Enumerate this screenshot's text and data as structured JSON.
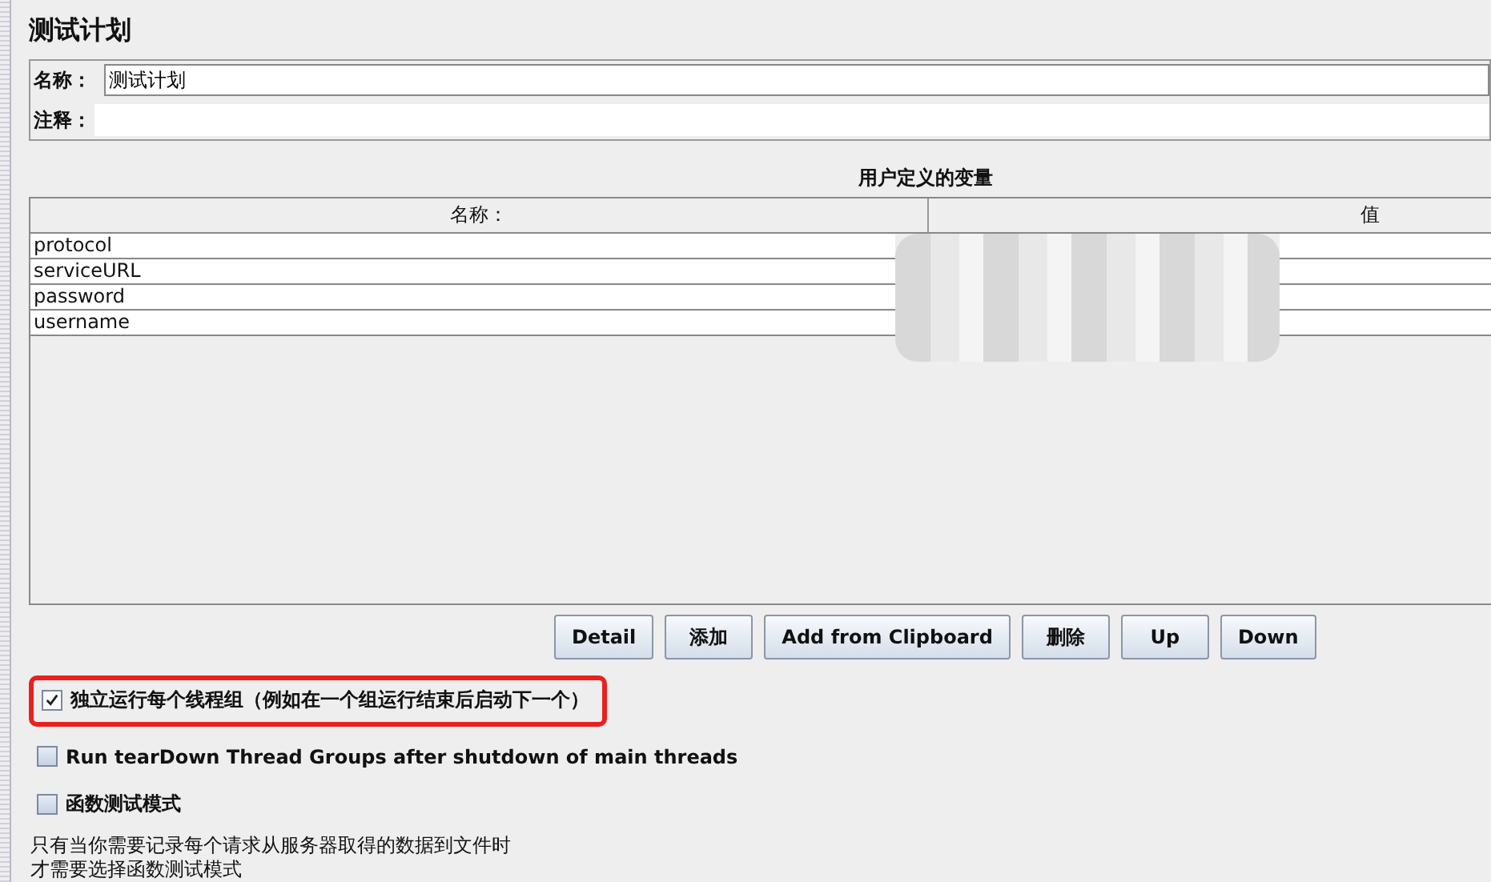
{
  "title": "测试计划",
  "name_field": {
    "label": "名称：",
    "value": "测试计划"
  },
  "comment_field": {
    "label": "注释："
  },
  "variables": {
    "title": "用户定义的变量",
    "columns": [
      "名称：",
      "值"
    ],
    "redacted": true,
    "rows": [
      {
        "name": "protocol"
      },
      {
        "name": "serviceURL"
      },
      {
        "name": "password"
      },
      {
        "name": "username"
      }
    ]
  },
  "buttons": [
    "Detail",
    "添加",
    "Add from Clipboard",
    "删除",
    "Up",
    "Down"
  ],
  "options": [
    {
      "label": "独立运行每个线程组（例如在一个组运行结束后启动下一个）",
      "checked": true,
      "highlighted": true
    },
    {
      "label": "Run tearDown Thread Groups after shutdown of main threads",
      "checked": false,
      "highlighted": false
    },
    {
      "label": "函数测试模式",
      "checked": false,
      "highlighted": false
    }
  ],
  "note": [
    "只有当你需要记录每个请求从服务器取得的数据到文件时",
    "才需要选择函数测试模式"
  ]
}
